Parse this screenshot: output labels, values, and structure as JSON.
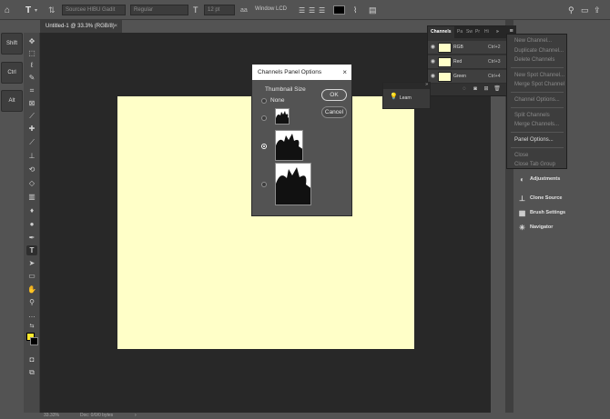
{
  "options_bar": {
    "font_family": "Sourcee HIBU Gadit",
    "font_style": "Regular",
    "font_size": "12 pt",
    "antialias": "Window LCD"
  },
  "document": {
    "tab_title": "Untitled-1 @ 33.3% (RGB/8)",
    "canvas_color": "#ffffc8",
    "zoom": "33.33%",
    "doc_info": "Doc: 0/0/0 bytes"
  },
  "left_column": {
    "shift_label": "Shift",
    "ctrl_label": "Ctrl",
    "alt_label": "Alt"
  },
  "tools": [
    "move-tool-icon",
    "marquee-tool-icon",
    "lasso-tool-icon",
    "quick-select-tool-icon",
    "crop-tool-icon",
    "frame-tool-icon",
    "eyedropper-tool-icon",
    "healing-brush-tool-icon",
    "brush-tool-icon",
    "clone-stamp-tool-icon",
    "history-brush-tool-icon",
    "eraser-tool-icon",
    "gradient-tool-icon",
    "blur-tool-icon",
    "dodge-tool-icon",
    "pen-tool-icon",
    "type-tool-icon",
    "path-select-tool-icon",
    "rectangle-tool-icon",
    "hand-tool-icon",
    "zoom-tool-icon",
    "more-tools-icon"
  ],
  "colors": {
    "foreground": "#ffe92e",
    "background": "#000000",
    "accent": "#ffffc8"
  },
  "channels_panel": {
    "tabs": [
      "Channels",
      "Pa",
      "Sw",
      "Pr",
      "Hi"
    ],
    "rows": [
      {
        "name": "RGB",
        "shortcut": "Ctrl+2"
      },
      {
        "name": "Red",
        "shortcut": "Ctrl+3"
      },
      {
        "name": "Green",
        "shortcut": "Ctrl+4"
      }
    ]
  },
  "flyout_menu": {
    "items": [
      {
        "label": "New Channel...",
        "enabled": false
      },
      {
        "label": "Duplicate Channel...",
        "enabled": false
      },
      {
        "label": "Delete Channels",
        "enabled": false
      },
      {
        "label": "New Spot Channel...",
        "enabled": false
      },
      {
        "label": "Merge Spot Channel",
        "enabled": false
      },
      {
        "label": "Channel Options...",
        "enabled": false
      },
      {
        "label": "Split Channels",
        "enabled": false
      },
      {
        "label": "Merge Channels...",
        "enabled": false
      },
      {
        "label": "Panel Options...",
        "enabled": true
      },
      {
        "label": "Close",
        "enabled": false
      },
      {
        "label": "Close Tab Group",
        "enabled": false
      }
    ]
  },
  "learn_panel": {
    "label": "Learn"
  },
  "right_panel": {
    "items": [
      "Adjustments",
      "Clone Source",
      "Brush Settings",
      "Navigator"
    ]
  },
  "dialog": {
    "title": "Channels Panel Options",
    "thumbnail_size_label": "Thumbnail Size",
    "none_label": "None",
    "selected_size": "medium",
    "ok_label": "OK",
    "cancel_label": "Cancel"
  }
}
